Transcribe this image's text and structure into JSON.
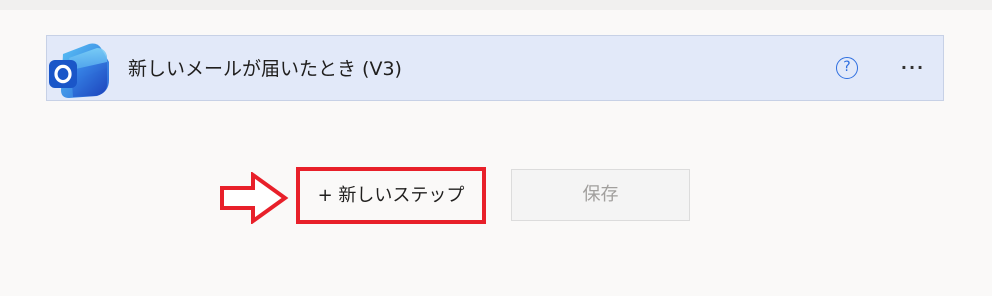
{
  "trigger": {
    "title": "新しいメールが届いたとき (V3)",
    "app_icon": "outlook-icon",
    "help_label": "?",
    "more_label": "···"
  },
  "actions": {
    "new_step_label": "+ 新しいステップ",
    "save_label": "保存"
  },
  "annotation": {
    "arrow_icon": "right-arrow-icon",
    "highlight_color": "#e8202a"
  },
  "colors": {
    "card_background": "#e2e9f9",
    "accent": "#2f6fe0",
    "page_background": "#faf9f8"
  }
}
